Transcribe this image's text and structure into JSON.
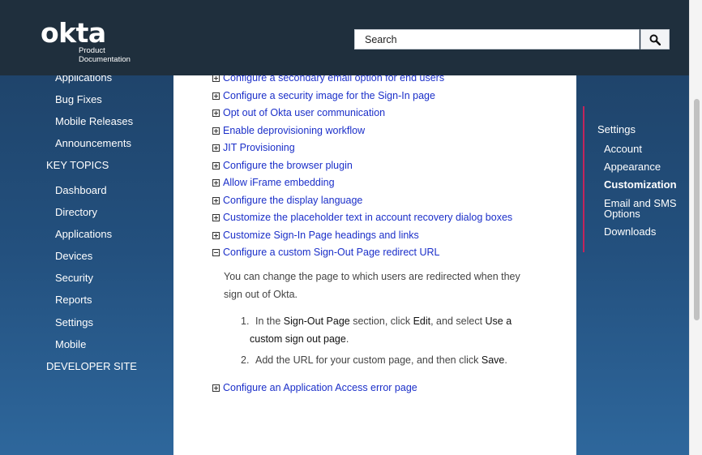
{
  "header": {
    "logo_text": "okta",
    "logo_sub_1": "Product",
    "logo_sub_2": "Documentation",
    "search_placeholder": "Search"
  },
  "left_nav": {
    "items": [
      {
        "label": "Applications"
      },
      {
        "label": "Bug Fixes"
      },
      {
        "label": "Mobile Releases"
      },
      {
        "label": "Announcements"
      },
      {
        "label": "KEY TOPICS"
      },
      {
        "label": "Dashboard"
      },
      {
        "label": "Directory"
      },
      {
        "label": "Applications"
      },
      {
        "label": "Devices"
      },
      {
        "label": "Security"
      },
      {
        "label": "Reports"
      },
      {
        "label": "Settings"
      },
      {
        "label": "Mobile"
      },
      {
        "label": "DEVELOPER SITE"
      }
    ]
  },
  "main": {
    "topics": [
      {
        "label": "Configure a secondary email option for end users",
        "expanded": false
      },
      {
        "label": "Configure a security image for the Sign-In page",
        "expanded": false
      },
      {
        "label": "Opt out of Okta user communication",
        "expanded": false
      },
      {
        "label": "Enable deprovisioning workflow",
        "expanded": false
      },
      {
        "label": "JIT Provisioning",
        "expanded": false
      },
      {
        "label": "Configure the browser plugin",
        "expanded": false
      },
      {
        "label": "Allow iFrame embedding",
        "expanded": false
      },
      {
        "label": "Configure the display language",
        "expanded": false
      },
      {
        "label": "Customize the placeholder text in account recovery dialog boxes",
        "expanded": false
      },
      {
        "label": "Customize Sign-In Page headings and links",
        "expanded": false
      },
      {
        "label": "Configure a custom Sign-Out Page redirect URL",
        "expanded": true
      },
      {
        "label": "Configure an Application Access error page",
        "expanded": false
      }
    ],
    "expanded_paragraph": "You can change the page to which users are redirected when they sign out of Okta.",
    "steps": {
      "step1": {
        "num": "1.",
        "t1": "In the ",
        "b1": "Sign-Out Page",
        "t2": " section, click ",
        "b2": "Edit",
        "t3": ", and select ",
        "b3": "Use a custom sign out page",
        "t4": "."
      },
      "step2": {
        "num": "2.",
        "t1": "Add the URL for your custom page, and then click ",
        "b1": "Save",
        "t2": "."
      }
    }
  },
  "right_nav": {
    "title": "Settings",
    "items": [
      {
        "label": "Account",
        "active": false
      },
      {
        "label": "Appearance",
        "active": false
      },
      {
        "label": "Customization",
        "active": true
      },
      {
        "label": "Email and SMS Options",
        "active": false
      },
      {
        "label": "Downloads",
        "active": false
      }
    ]
  },
  "colors": {
    "header_bg": "#1f2f3d",
    "link": "#1b2fc9",
    "accent_bar": "#c2255c",
    "side_bg": "#23507e"
  }
}
